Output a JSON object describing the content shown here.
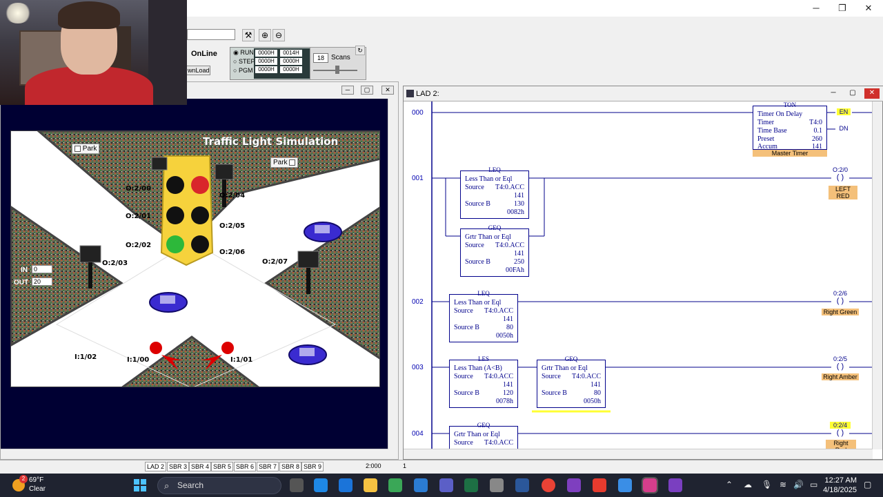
{
  "window": {
    "minimize": "─",
    "maximize": "❐",
    "close": "✕"
  },
  "toolbar": {
    "online": "OnLine",
    "download": "wnLoad",
    "modes": [
      "RUN",
      "STEP",
      "PGM"
    ],
    "registers": [
      [
        "0000H",
        "0014H"
      ],
      [
        "0000H",
        "0000H"
      ],
      [
        "0000H",
        "0000H"
      ]
    ],
    "scans_value": "18",
    "scans_label": "Scans"
  },
  "sim": {
    "title": "Traffic Light Simulation",
    "park_left": "Park",
    "park_right": "Park",
    "outputs": [
      "O:2/00",
      "O:2/01",
      "O:2/02",
      "O:2/03",
      "O:2/04",
      "O:2/05",
      "O:2/06",
      "O:2/07"
    ],
    "inputs": [
      "I:1/02",
      "I:1/00",
      "I:1/01"
    ],
    "in_label": "IN",
    "in_value": "0",
    "out_label": "OUT",
    "out_value": "20"
  },
  "ladder": {
    "title": "LAD 2:",
    "rungs": [
      "000",
      "001",
      "002",
      "003",
      "004"
    ],
    "ton": {
      "head": "TON",
      "name": "Timer On Delay",
      "timer_label": "Timer",
      "timer": "T4:0",
      "base_label": "Time Base",
      "base": "0.1",
      "preset_label": "Preset",
      "preset": "260",
      "accum_label": "Accum",
      "accum": "141",
      "tag": "Master Timer",
      "en": "EN",
      "dn": "DN"
    },
    "r1_leq": {
      "head": "LEQ",
      "name": "Less Than or Eql",
      "src_label": "Source",
      "src": "T4:0.ACC",
      "src_val": "141",
      "srcb_label": "Source B",
      "srcb": "130",
      "srcb_hex": "0082h"
    },
    "r1_geq": {
      "head": "GEQ",
      "name": "Grtr Than or Eql",
      "src_label": "Source",
      "src": "T4:0.ACC",
      "src_val": "141",
      "srcb_label": "Source B",
      "srcb": "250",
      "srcb_hex": "00FAh"
    },
    "r1_coil": {
      "addr": "O:2/0",
      "tag": "LEFT RED"
    },
    "r2_leq": {
      "head": "LEQ",
      "name": "Less Than or Eql",
      "src_label": "Source",
      "src": "T4:0.ACC",
      "src_val": "141",
      "srcb_label": "Source B",
      "srcb": "80",
      "srcb_hex": "0050h"
    },
    "r2_coil": {
      "addr": "0:2/6",
      "tag": "Right Green"
    },
    "r3_les": {
      "head": "LES",
      "name": "Less Than (A<B)",
      "src_label": "Source",
      "src": "T4:0.ACC",
      "src_val": "141",
      "srcb_label": "Source B",
      "srcb": "120",
      "srcb_hex": "0078h"
    },
    "r3_geq": {
      "head": "GEQ",
      "name": "Grtr Than or Eql",
      "src_label": "Source",
      "src": "T4:0.ACC",
      "src_val": "141",
      "srcb_label": "Source B",
      "srcb": "80",
      "srcb_hex": "0050h"
    },
    "r3_coil": {
      "addr": "0:2/5",
      "tag": "Right Amber"
    },
    "r4_geq": {
      "head": "GEQ",
      "name": "Grtr Than or Eql",
      "src_label": "Source",
      "src": "T4:0.ACC"
    },
    "r4_coil": {
      "addr": "0:2/4",
      "tag": "Right Red"
    }
  },
  "status": {
    "tabs": [
      "LAD 2",
      "SBR 3",
      "SBR 4",
      "SBR 5",
      "SBR 6",
      "SBR 7",
      "SBR 8",
      "SBR 9"
    ],
    "addr": "2:000",
    "count": "1"
  },
  "taskbar": {
    "weather_badge": "2",
    "temp": "69°F",
    "cond": "Clear",
    "search": "Search",
    "time": "12:27 AM",
    "date": "4/18/2025"
  },
  "colors": {
    "light_red": "#d9262b",
    "light_green": "#2db83a",
    "light_off": "#111111",
    "housing": "#f6d23c",
    "coil_tag": "#f4c07a",
    "highlight": "#ffff33"
  }
}
